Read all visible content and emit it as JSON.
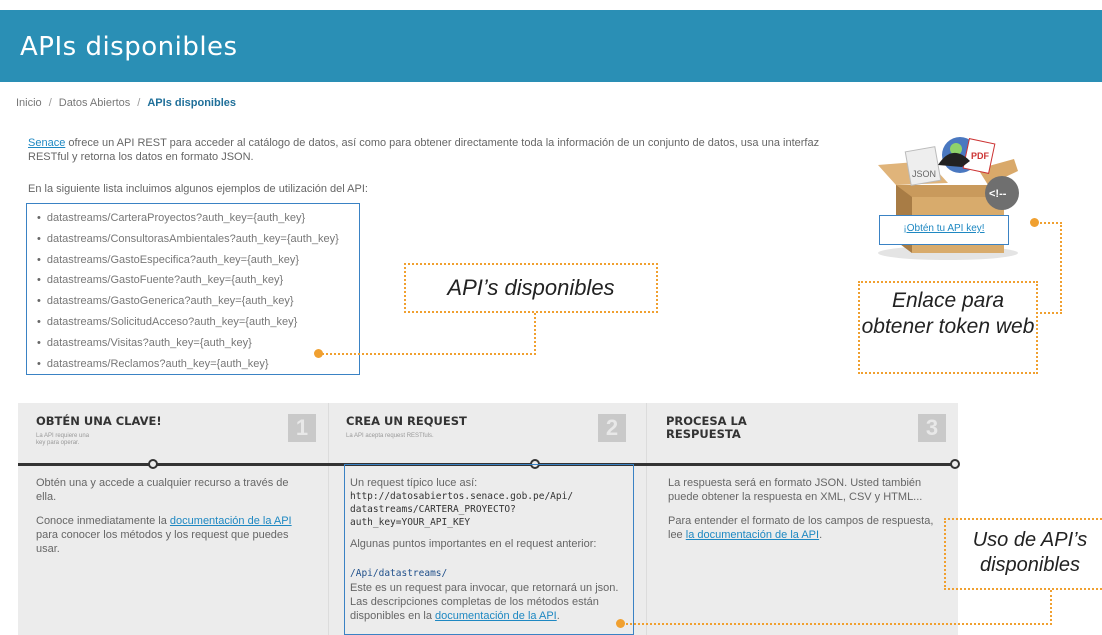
{
  "header": {
    "title": "APIs disponibles"
  },
  "breadcrumb": {
    "items": [
      "Inicio",
      "Datos Abiertos"
    ],
    "current": "APIs disponibles",
    "separator": "/"
  },
  "intro": {
    "link": "Senace",
    "text": " ofrece un API REST para acceder al catálogo de datos, así como para obtener directamente toda la información de un conjunto de datos, usa una interfaz RESTful y retorna los datos en formato JSON."
  },
  "examples_label": "En la siguiente lista incluimos algunos ejemplos de utilización del API:",
  "api_list": [
    "datastreams/CarteraProyectos?auth_key={auth_key}",
    "datastreams/ConsultorasAmbientales?auth_key={auth_key}",
    "datastreams/GastoEspecifica?auth_key={auth_key}",
    "datastreams/GastoFuente?auth_key={auth_key}",
    "datastreams/GastoGenerica?auth_key={auth_key}",
    "datastreams/SolicitudAcceso?auth_key={auth_key}",
    "datastreams/Visitas?auth_key={auth_key}",
    "datastreams/Reclamos?auth_key={auth_key}"
  ],
  "callouts": {
    "apis": "API’s disponibles",
    "token": "Enlace para obtener token web",
    "usage": "Uso de API’s disponibles"
  },
  "key_link": "¡Obtén tu API key!",
  "box_labels": {
    "json": "JSON",
    "pdf": "PDF",
    "tag": "<!--"
  },
  "steps": [
    {
      "title": "OBTÉN UNA CLAVE!",
      "subtitle": "La API requiere una key para operar.",
      "number": "1"
    },
    {
      "title": "CREA UN REQUEST",
      "subtitle": "La API acepta request RESTfuls.",
      "number": "2"
    },
    {
      "title": "PROCESA LA RESPUESTA",
      "subtitle": "",
      "number": "3"
    }
  ],
  "col1": {
    "p1": "Obtén una y accede a cualquier recurso a través de ella.",
    "p2_before": "Conoce inmediatamente la ",
    "p2_link": "documentación de la API",
    "p2_after": " para conocer los métodos y los request que puedes usar."
  },
  "col2": {
    "intro": "Un request típico luce así:",
    "code": "http://datosabiertos.senace.gob.pe/Api/\ndatastreams/CARTERA_PROYECTO?\nauth_key=YOUR_API_KEY",
    "points": "Algunas puntos importantes en el request anterior:",
    "path": "/Api/datastreams/",
    "desc_before": "Este es un request para invocar, que retornará un json. Las descripciones completas de los métodos están disponibles en la ",
    "desc_link": "documentación de la API",
    "desc_after": "."
  },
  "col3": {
    "p1": "La respuesta será en formato JSON. Usted también puede obtener la respuesta en XML, CSV y HTML...",
    "p2_before": "Para entender el formato de los campos de respuesta, lee ",
    "p2_link": "la documentación de la API",
    "p2_after": "."
  },
  "colors": {
    "header": "#2a8fb5",
    "link": "#1e88c2",
    "highlight_border": "#3a82c4",
    "callout": "#f0a030"
  }
}
